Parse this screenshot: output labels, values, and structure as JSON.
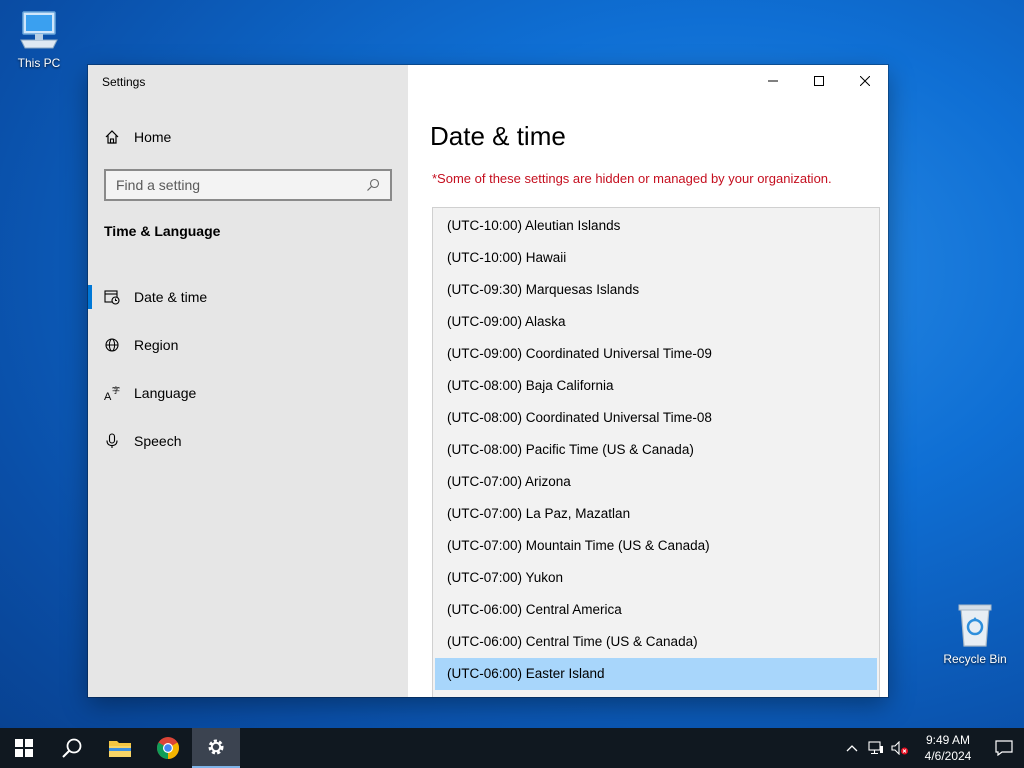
{
  "desktop": {
    "icons": [
      {
        "label": "This PC"
      },
      {
        "label": "Recycle Bin"
      }
    ]
  },
  "window": {
    "app_title": "Settings",
    "controls": [
      "minimize",
      "maximize",
      "close"
    ]
  },
  "sidebar": {
    "home_label": "Home",
    "search_placeholder": "Find a setting",
    "section_title": "Time & Language",
    "items": [
      {
        "label": "Date & time",
        "icon": "calendar-clock-icon",
        "active": true
      },
      {
        "label": "Region",
        "icon": "globe-icon",
        "active": false
      },
      {
        "label": "Language",
        "icon": "language-icon",
        "active": false
      },
      {
        "label": "Speech",
        "icon": "microphone-icon",
        "active": false
      }
    ]
  },
  "main": {
    "title": "Date & time",
    "managed_note": "*Some of these settings are hidden or managed by your organization.",
    "timezones": [
      "(UTC-10:00) Aleutian Islands",
      "(UTC-10:00) Hawaii",
      "(UTC-09:30) Marquesas Islands",
      "(UTC-09:00) Alaska",
      "(UTC-09:00) Coordinated Universal Time-09",
      "(UTC-08:00) Baja California",
      "(UTC-08:00) Coordinated Universal Time-08",
      "(UTC-08:00) Pacific Time (US & Canada)",
      "(UTC-07:00) Arizona",
      "(UTC-07:00) La Paz, Mazatlan",
      "(UTC-07:00) Mountain Time (US & Canada)",
      "(UTC-07:00) Yukon",
      "(UTC-06:00) Central America",
      "(UTC-06:00) Central Time (US & Canada)",
      "(UTC-06:00) Easter Island"
    ],
    "selected_timezone": "(UTC-06:00) Easter Island"
  },
  "taskbar": {
    "apps": [
      "start",
      "search",
      "file-explorer",
      "chrome",
      "settings"
    ],
    "clock_time": "9:49 AM",
    "clock_date": "4/6/2024"
  },
  "colors": {
    "accent": "#0078d7",
    "warning": "#c50f1f",
    "selection": "#a8d6fb"
  }
}
